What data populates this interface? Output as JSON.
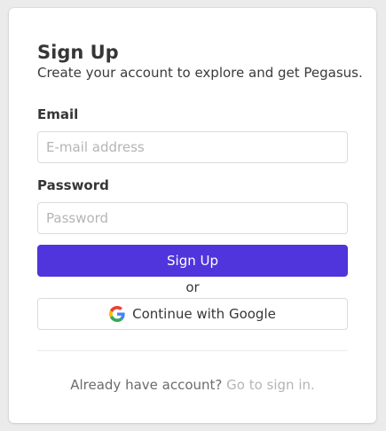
{
  "signup": {
    "title": "Sign Up",
    "subtitle": "Create your account to explore and get Pegasus.",
    "email_label": "Email",
    "email_placeholder": "E-mail address",
    "email_value": "",
    "password_label": "Password",
    "password_placeholder": "Password",
    "password_value": "",
    "submit_label": "Sign Up",
    "or_text": "or",
    "google_label": "Continue with Google",
    "footer_text": "Already have account?",
    "signin_link": "Go to sign in."
  },
  "colors": {
    "primary": "#4f35db",
    "background": "#ebebeb",
    "link": "#b5b5b5"
  },
  "icons": {
    "google": "google-logo-icon"
  }
}
